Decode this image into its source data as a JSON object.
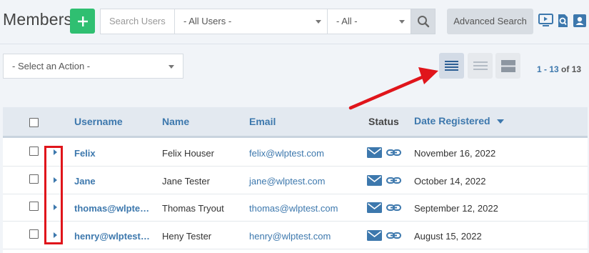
{
  "header": {
    "title": "Members",
    "search_placeholder": "Search Users",
    "user_filter_value": "- All Users -",
    "status_filter_value": "- All -",
    "advanced_search_label": "Advanced Search"
  },
  "actions": {
    "action_select_value": "- Select an Action -"
  },
  "pagination": {
    "range": "1 - 13",
    "of_label": "of",
    "total": "13"
  },
  "table": {
    "columns": {
      "username": "Username",
      "name": "Name",
      "email": "Email",
      "status": "Status",
      "date_registered": "Date Registered"
    },
    "sort_column": "date_registered",
    "rows": [
      {
        "username": "Felix",
        "name": "Felix Houser",
        "email": "felix@wlptest.com",
        "date": "November 16, 2022"
      },
      {
        "username": "Jane",
        "name": "Jane Tester",
        "email": "jane@wlptest.com",
        "date": "October 14, 2022"
      },
      {
        "username": "thomas@wlpte…",
        "name": "Thomas Tryout",
        "email": "thomas@wlptest.com",
        "date": "September 12, 2022"
      },
      {
        "username": "henry@wlptest…",
        "name": "Heny Tester",
        "email": "henry@wlptest.com",
        "date": "August 15, 2022"
      }
    ]
  },
  "icons": {
    "add": "plus-icon",
    "search": "magnifier-icon",
    "status_mail": "envelope-icon",
    "status_link": "link-icon",
    "view_compact": "compact-list-icon",
    "view_normal": "list-icon",
    "view_large": "large-rows-icon",
    "top_right": [
      "video-screen-icon",
      "search-document-icon",
      "user-card-icon"
    ]
  },
  "colors": {
    "accent": "#3d78ad",
    "add_button": "#2fbf71",
    "annotation_red": "#e0151b",
    "header_bg": "#e3e9f0",
    "page_bg": "#f1f4f8"
  }
}
